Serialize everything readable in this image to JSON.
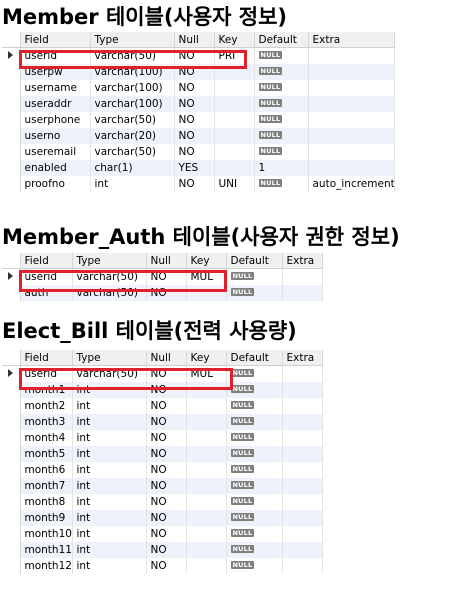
{
  "section1": {
    "title": "Member 테이블(사용자 정보)",
    "columns": [
      "Field",
      "Type",
      "Null",
      "Key",
      "Default",
      "Extra"
    ],
    "rows": [
      {
        "field": "userid",
        "type": "varchar(50)",
        "null": "NO",
        "key": "PRI",
        "default": "NULL",
        "extra": ""
      },
      {
        "field": "userpw",
        "type": "varchar(100)",
        "null": "NO",
        "key": "",
        "default": "NULL",
        "extra": ""
      },
      {
        "field": "username",
        "type": "varchar(100)",
        "null": "NO",
        "key": "",
        "default": "NULL",
        "extra": ""
      },
      {
        "field": "useraddr",
        "type": "varchar(100)",
        "null": "NO",
        "key": "",
        "default": "NULL",
        "extra": ""
      },
      {
        "field": "userphone",
        "type": "varchar(50)",
        "null": "NO",
        "key": "",
        "default": "NULL",
        "extra": ""
      },
      {
        "field": "userno",
        "type": "varchar(20)",
        "null": "NO",
        "key": "",
        "default": "NULL",
        "extra": ""
      },
      {
        "field": "useremail",
        "type": "varchar(50)",
        "null": "NO",
        "key": "",
        "default": "NULL",
        "extra": ""
      },
      {
        "field": "enabled",
        "type": "char(1)",
        "null": "YES",
        "key": "",
        "default": "1",
        "extra": ""
      },
      {
        "field": "proofno",
        "type": "int",
        "null": "NO",
        "key": "UNI",
        "default": "NULL",
        "extra": "auto_increment"
      }
    ]
  },
  "section2": {
    "title": "Member_Auth 테이블(사용자 권한 정보)",
    "columns": [
      "Field",
      "Type",
      "Null",
      "Key",
      "Default",
      "Extra"
    ],
    "rows": [
      {
        "field": "userid",
        "type": "varchar(50)",
        "null": "NO",
        "key": "MUL",
        "default": "NULL",
        "extra": ""
      },
      {
        "field": "auth",
        "type": "varchar(50)",
        "null": "NO",
        "key": "",
        "default": "NULL",
        "extra": ""
      }
    ]
  },
  "section3": {
    "title": "Elect_Bill 테이블(전력 사용량)",
    "columns": [
      "Field",
      "Type",
      "Null",
      "Key",
      "Default",
      "Extra"
    ],
    "rows": [
      {
        "field": "userid",
        "type": "varchar(50)",
        "null": "NO",
        "key": "MUL",
        "default": "NULL",
        "extra": ""
      },
      {
        "field": "month1",
        "type": "int",
        "null": "NO",
        "key": "",
        "default": "NULL",
        "extra": ""
      },
      {
        "field": "month2",
        "type": "int",
        "null": "NO",
        "key": "",
        "default": "NULL",
        "extra": ""
      },
      {
        "field": "month3",
        "type": "int",
        "null": "NO",
        "key": "",
        "default": "NULL",
        "extra": ""
      },
      {
        "field": "month4",
        "type": "int",
        "null": "NO",
        "key": "",
        "default": "NULL",
        "extra": ""
      },
      {
        "field": "month5",
        "type": "int",
        "null": "NO",
        "key": "",
        "default": "NULL",
        "extra": ""
      },
      {
        "field": "month6",
        "type": "int",
        "null": "NO",
        "key": "",
        "default": "NULL",
        "extra": ""
      },
      {
        "field": "month7",
        "type": "int",
        "null": "NO",
        "key": "",
        "default": "NULL",
        "extra": ""
      },
      {
        "field": "month8",
        "type": "int",
        "null": "NO",
        "key": "",
        "default": "NULL",
        "extra": ""
      },
      {
        "field": "month9",
        "type": "int",
        "null": "NO",
        "key": "",
        "default": "NULL",
        "extra": ""
      },
      {
        "field": "month10",
        "type": "int",
        "null": "NO",
        "key": "",
        "default": "NULL",
        "extra": ""
      },
      {
        "field": "month11",
        "type": "int",
        "null": "NO",
        "key": "",
        "default": "NULL",
        "extra": ""
      },
      {
        "field": "month12",
        "type": "int",
        "null": "NO",
        "key": "",
        "default": "NULL",
        "extra": ""
      }
    ]
  },
  "colors": {
    "highlight": "#e0202a",
    "row_alt": "#eef2fb",
    "header_bg": "#f0f0f0",
    "null_badge": "#7f7f7f"
  }
}
